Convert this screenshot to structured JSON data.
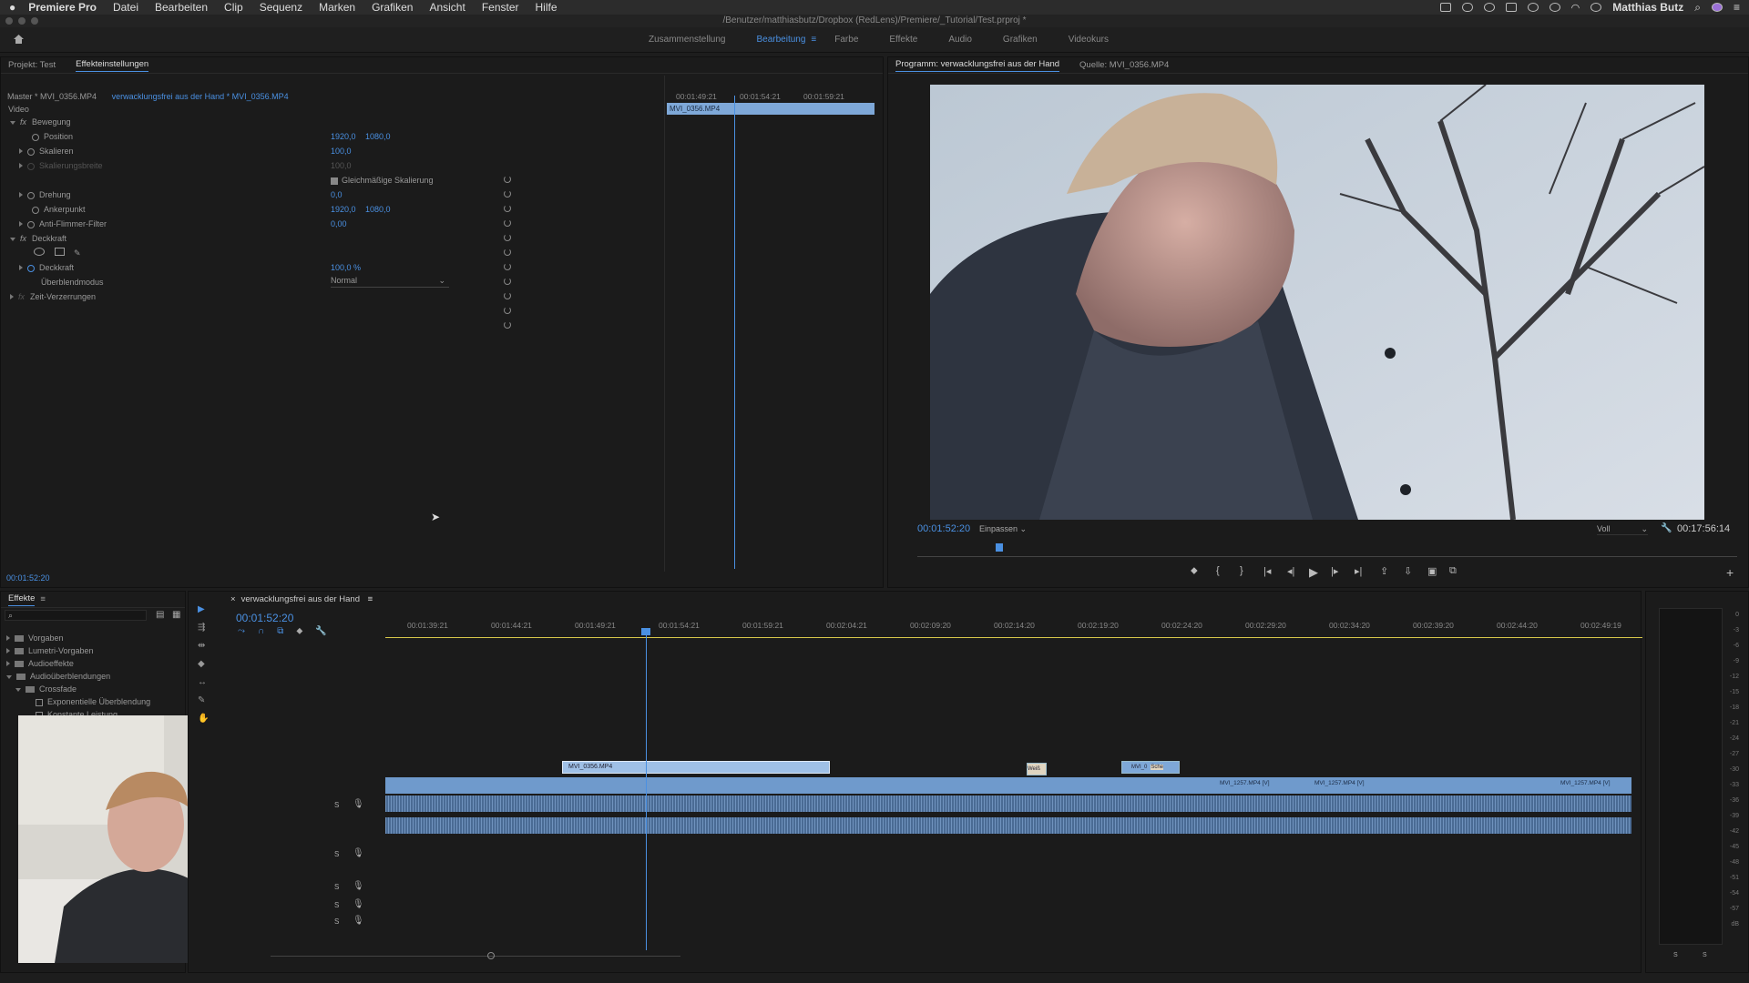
{
  "menubar": {
    "app": "Premiere Pro",
    "items": [
      "Datei",
      "Bearbeiten",
      "Clip",
      "Sequenz",
      "Marken",
      "Grafiken",
      "Ansicht",
      "Fenster",
      "Hilfe"
    ],
    "user": "Matthias Butz"
  },
  "titlebar": {
    "path": "/Benutzer/matthiasbutz/Dropbox (RedLens)/Premiere/_Tutorial/Test.prproj *"
  },
  "workspaces": [
    {
      "label": "Zusammenstellung"
    },
    {
      "label": "Bearbeitung",
      "active": true
    },
    {
      "label": "Farbe"
    },
    {
      "label": "Effekte"
    },
    {
      "label": "Audio"
    },
    {
      "label": "Grafiken"
    },
    {
      "label": "Videokurs"
    }
  ],
  "effect_controls": {
    "tab_project": "Projekt: Test",
    "tab_effects": "Effekteinstellungen",
    "master": "Master * MVI_0356.MP4",
    "clip": "verwacklungsfrei aus der Hand * MVI_0356.MP4",
    "video_label": "Video",
    "bewegung": "Bewegung",
    "position": "Position",
    "position_x": "1920,0",
    "position_y": "1080,0",
    "skalieren": "Skalieren",
    "skalieren_val": "100,0",
    "skalierungsbreite": "Skalierungsbreite",
    "skalierungsbreite_val": "100,0",
    "gleichmaessig": "Gleichmäßige Skalierung",
    "drehung": "Drehung",
    "drehung_val": "0,0",
    "ankerpunkt": "Ankerpunkt",
    "anker_x": "1920,0",
    "anker_y": "1080,0",
    "antiflimmer": "Anti-Flimmer-Filter",
    "antiflimmer_val": "0,00",
    "deckkraft_group": "Deckkraft",
    "deckkraft": "Deckkraft",
    "deckkraft_val": "100,0 %",
    "ueberblend": "Überblendmodus",
    "ueberblend_val": "Normal",
    "zeitverzerrung": "Zeit-Verzerrungen",
    "timecode": "00:01:52:20",
    "mini_ticks": [
      "00:01:49:21",
      "00:01:54:21",
      "00:01:59:21"
    ],
    "mini_clip": "MVI_0356.MP4"
  },
  "program": {
    "tab_program": "Programm: verwacklungsfrei aus der Hand",
    "tab_source": "Quelle: MVI_0356.MP4",
    "timecode": "00:01:52:20",
    "fit": "Einpassen",
    "quality": "Voll",
    "duration": "00:17:56:14",
    "playhead_frac": 0.1
  },
  "effects_panel": {
    "title": "Effekte",
    "items": [
      {
        "label": "Vorgaben",
        "level": 0
      },
      {
        "label": "Lumetri-Vorgaben",
        "level": 0
      },
      {
        "label": "Audioeffekte",
        "level": 0
      },
      {
        "label": "Audioüberblendungen",
        "level": 0
      },
      {
        "label": "Crossfade",
        "level": 1
      },
      {
        "label": "Exponentielle Überblendung",
        "level": 2
      },
      {
        "label": "Konstante Leistung",
        "level": 2
      }
    ]
  },
  "timeline": {
    "title": "verwacklungsfrei aus der Hand",
    "timecode": "00:01:52:20",
    "ticks": [
      "00:01:39:21",
      "00:01:44:21",
      "00:01:49:21",
      "00:01:54:21",
      "00:01:59:21",
      "00:02:04:21",
      "00:02:09:20",
      "00:02:14:20",
      "00:02:19:20",
      "00:02:24:20",
      "00:02:29:20",
      "00:02:34:20",
      "00:02:39:20",
      "00:02:44:20",
      "00:02:49:19"
    ],
    "clip_v2_a": "MVI_0356.MP4",
    "clip_v2_b": "Weiß",
    "clip_v2_c": "MVI_0",
    "clip_v2_d": "Sche",
    "clip_v1_a": "MVI_1257.MP4 [V]",
    "clip_v1_b": "MVI_1257.MP4 [V]",
    "clip_v1_c": "MVI_1257.MP4 [V]",
    "track_s": "S"
  },
  "meter": {
    "labels": [
      "0",
      "-3",
      "-6",
      "-9",
      "-12",
      "-15",
      "-18",
      "-21",
      "-24",
      "-27",
      "-30",
      "-33",
      "-36",
      "-39",
      "-42",
      "-45",
      "-48",
      "-51",
      "-54",
      "-57",
      "dB"
    ],
    "foot": [
      "S",
      "S"
    ]
  }
}
